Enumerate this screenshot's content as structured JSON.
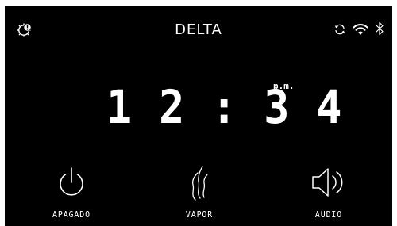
{
  "header": {
    "brand": "DELTA",
    "settings_icon": "gear-alert-icon",
    "status_icons": [
      "sync-icon",
      "wifi-icon",
      "bluetooth-icon"
    ]
  },
  "clock": {
    "time": "12:34",
    "period": "p.m."
  },
  "controls": [
    {
      "label": "APAGADO",
      "icon": "power-icon"
    },
    {
      "label": "VAPOR",
      "icon": "steam-icon"
    },
    {
      "label": "AUDIO",
      "icon": "speaker-icon"
    }
  ],
  "colors": {
    "background": "#000000",
    "foreground": "#ffffff"
  }
}
